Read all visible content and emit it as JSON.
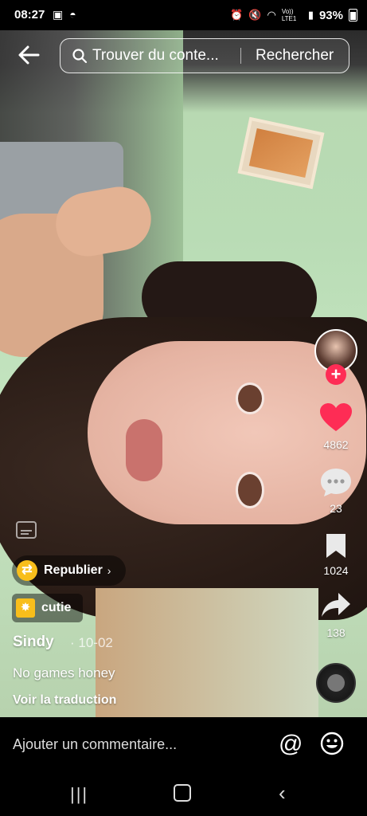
{
  "status": {
    "time": "08:27",
    "battery": "93%",
    "network": "Vo)) LTE1"
  },
  "search": {
    "placeholder": "Trouver du conte...",
    "button": "Rechercher"
  },
  "actions": {
    "likes": "4862",
    "comments": "23",
    "saves": "1024",
    "shares": "138"
  },
  "post": {
    "repost_label": "Republier",
    "tag_label": "cutie",
    "username": "Sindy",
    "date": "· 10-02",
    "caption": "No games honey",
    "translate_label": "Voir la traduction"
  },
  "comment": {
    "placeholder": "Ajouter un commentaire..."
  },
  "colors": {
    "like": "#fe2c55",
    "repost": "#f8be1b"
  },
  "icons": [
    "back-arrow-icon",
    "search-icon",
    "heart-icon",
    "comment-icon",
    "bookmark-icon",
    "share-icon",
    "captions-icon",
    "repost-icon",
    "at-icon",
    "emoji-icon"
  ]
}
